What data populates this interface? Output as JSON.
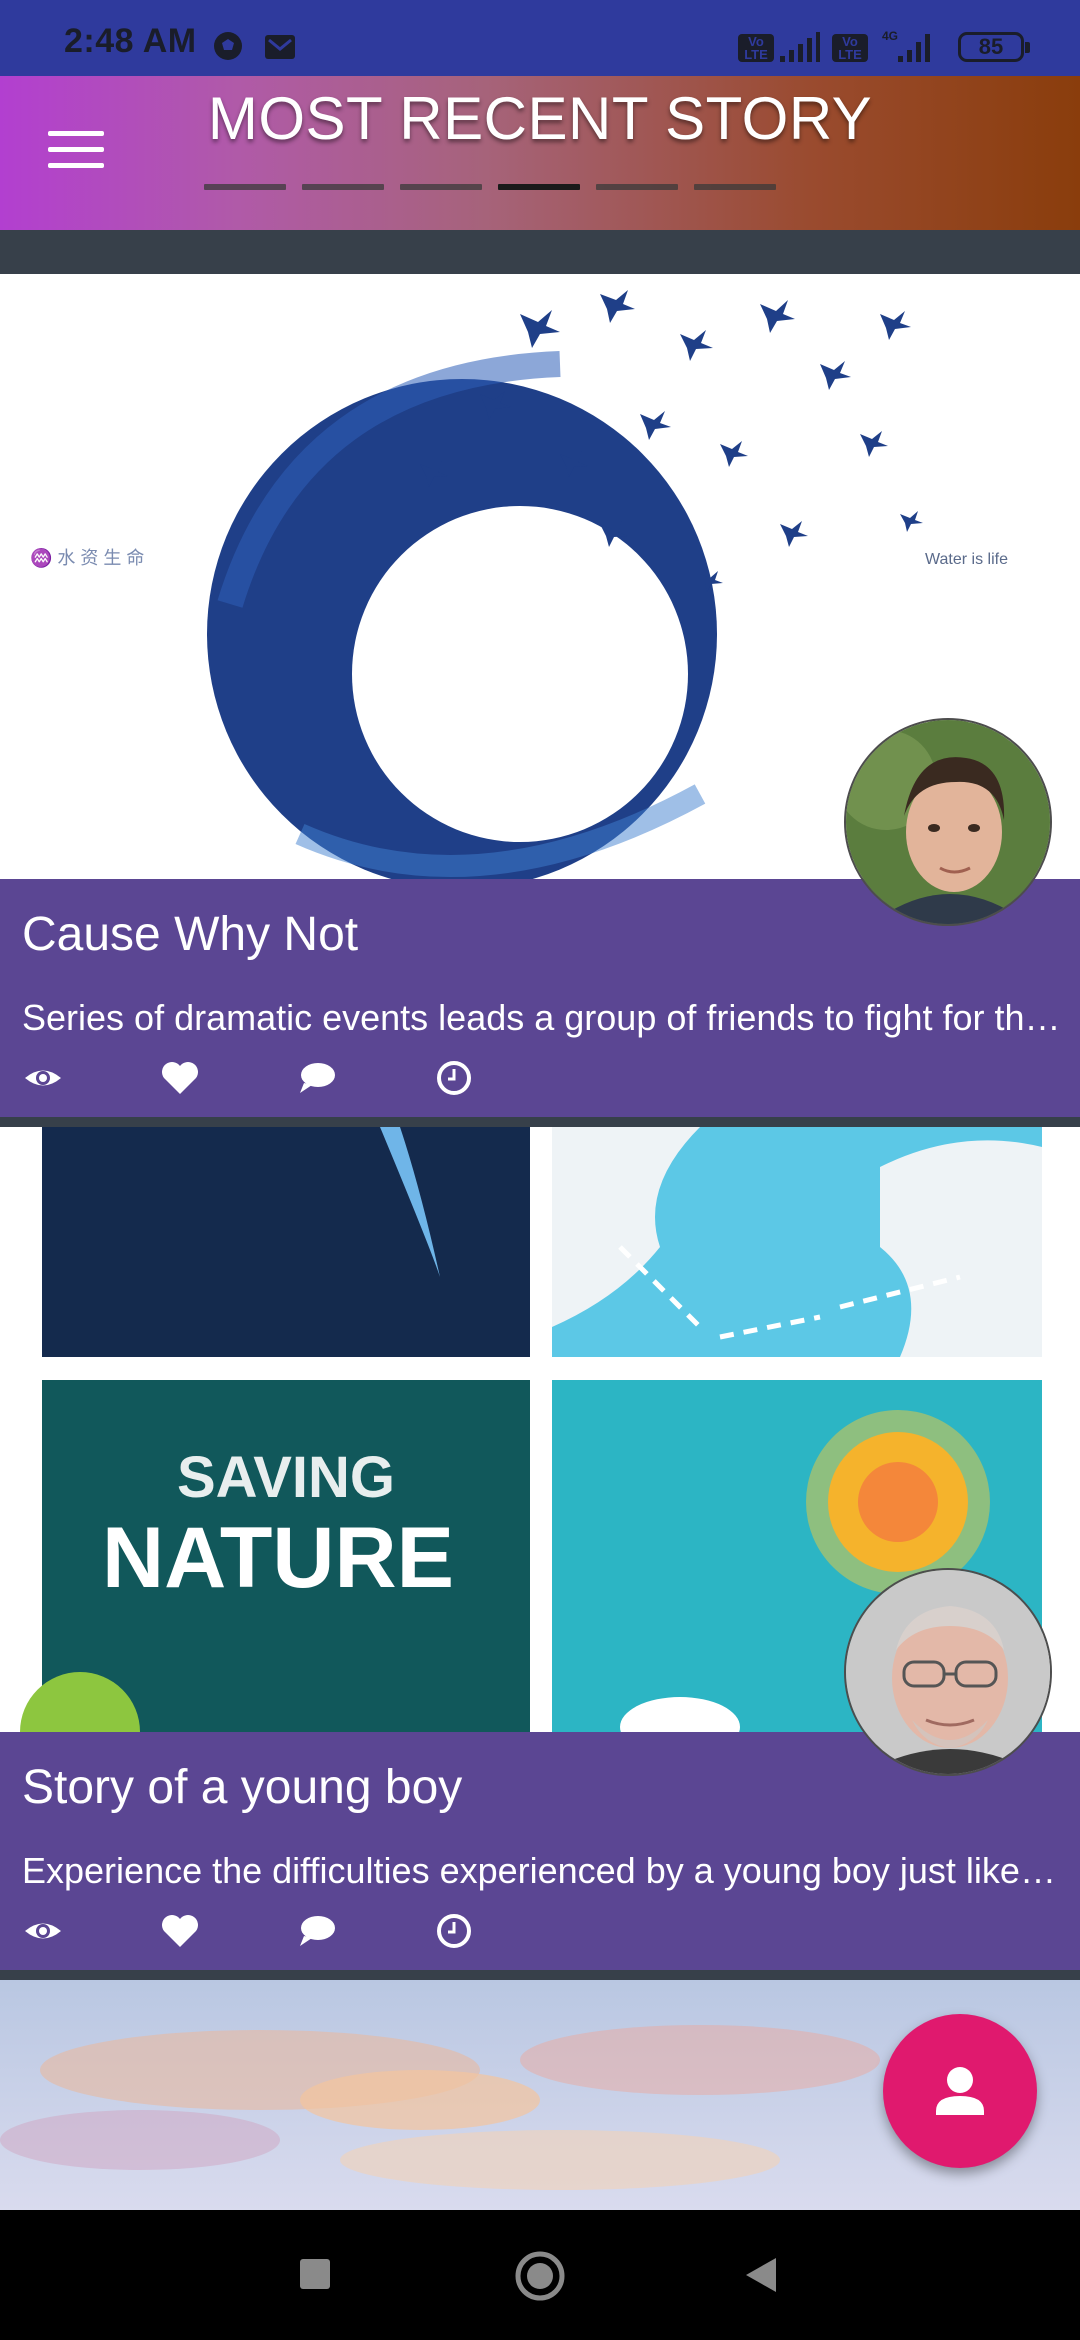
{
  "status_bar": {
    "time": "2:48 AM",
    "battery": "85",
    "icons": [
      "soccer-ball-icon",
      "mail-icon",
      "volte-icon",
      "signal-icon",
      "4g-icon"
    ],
    "badge1": "Vo\nLTE",
    "badge2": "Vo\nLTE",
    "net": "4G"
  },
  "header": {
    "title": "MOST RECENT STORY",
    "tabs_count": 6,
    "active_tab": 3,
    "colors": {
      "start": "#b23fd0",
      "end": "#8a3d0c"
    }
  },
  "stories": [
    {
      "title": "Cause Why Not",
      "description": "Series of dramatic events leads a group of friends to fight for their lives",
      "image_texts": {
        "left": "♒ 水 资 生 命",
        "right": "Water is life"
      }
    },
    {
      "title": "Story of a young boy",
      "description": "Experience the difficulties experienced by a young boy just like you",
      "image_texts": {
        "line1": "SAVING",
        "line2": "NATURE"
      }
    }
  ],
  "colors": {
    "panel": "#5b4693",
    "fab": "#e0196e",
    "statusbar": "#2f3a9d"
  }
}
